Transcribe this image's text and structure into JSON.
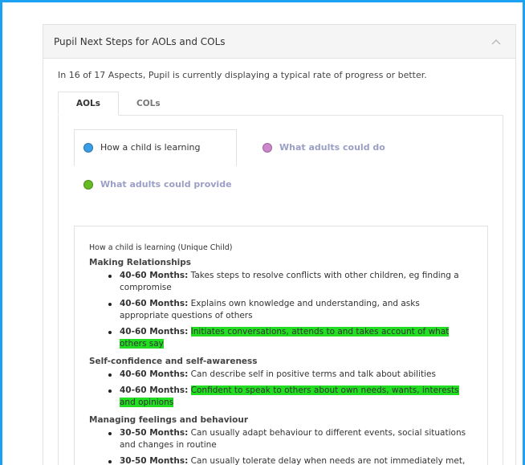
{
  "panel": {
    "title": "Pupil Next Steps for AOLs and COLs",
    "summary": "In 16 of 17 Aspects, Pupil is currently displaying a typical rate of progress or better."
  },
  "tabs": [
    {
      "label": "AOLs",
      "active": true
    },
    {
      "label": "COLs",
      "active": false
    }
  ],
  "subtabs": [
    {
      "label": "How a child is learning",
      "color": "#3a9ee6",
      "active": true
    },
    {
      "label": "What adults could do",
      "color": "#cc88cc",
      "active": false
    },
    {
      "label": "What adults could provide",
      "color": "#66bb22",
      "active": false
    }
  ],
  "content": {
    "heading": "How a child is learning (Unique Child)",
    "sections": [
      {
        "title": "Making Relationships",
        "items": [
          {
            "label": "40-60 Months:",
            "text": "Takes steps to resolve conflicts with other children, eg finding a compromise",
            "highlight": false
          },
          {
            "label": "40-60 Months:",
            "text": "Explains own knowledge and understanding, and asks appropriate questions of others",
            "highlight": false
          },
          {
            "label": "40-60 Months:",
            "text": "Initiates conversations, attends to and takes account of what others say",
            "highlight": true
          }
        ]
      },
      {
        "title": "Self-confidence and self-awareness",
        "items": [
          {
            "label": "40-60 Months:",
            "text": "Can describe self in positive terms and talk about abilities",
            "highlight": false
          },
          {
            "label": "40-60 Months:",
            "text": "Confident to speak to others about own needs, wants, interests and opinions",
            "highlight": true
          }
        ]
      },
      {
        "title": "Managing feelings and behaviour",
        "items": [
          {
            "label": "30-50 Months:",
            "text": "Can usually adapt behaviour to different events, social situations and changes in routine",
            "highlight": false
          },
          {
            "label": "30-50 Months:",
            "text": "Can usually tolerate delay when needs are not immediately met, and understands wishes may not always be met",
            "highlight": false
          }
        ]
      }
    ]
  },
  "colors": {
    "frame_border": "#1da1f2",
    "highlight": "#22dd22"
  }
}
